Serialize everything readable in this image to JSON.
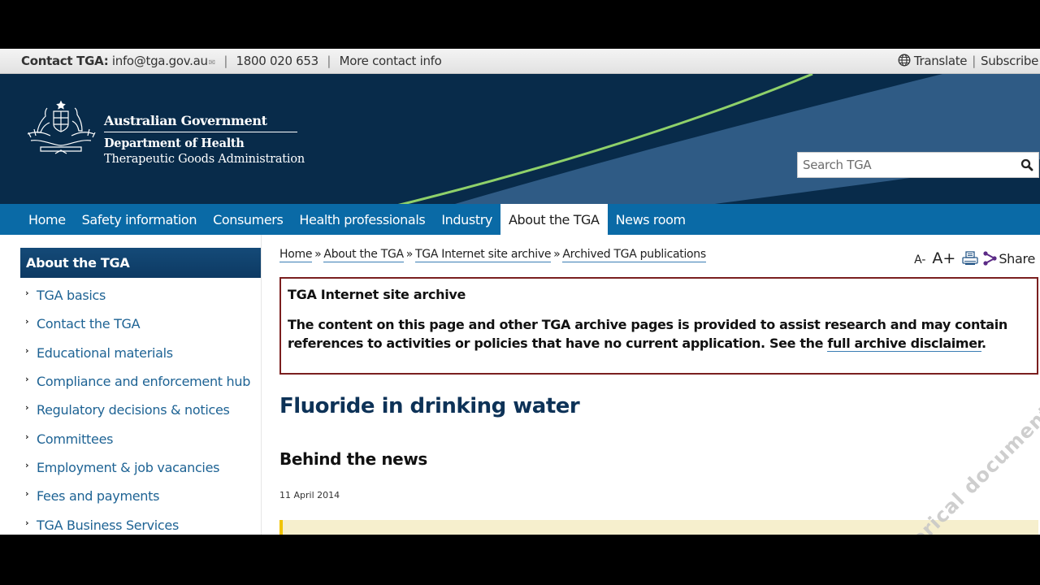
{
  "topbar": {
    "contact_label": "Contact TGA:",
    "email": "info@tga.gov.au",
    "phone": "1800 020 653",
    "more_contact": "More contact info",
    "translate": "Translate",
    "subscribe": "Subscribe",
    "separator": "|"
  },
  "header": {
    "government": "Australian Government",
    "department": "Department of Health",
    "agency": "Therapeutic Goods Administration",
    "search_placeholder": "Search TGA"
  },
  "nav": {
    "items": [
      {
        "label": "Home",
        "active": false
      },
      {
        "label": "Safety information",
        "active": false
      },
      {
        "label": "Consumers",
        "active": false
      },
      {
        "label": "Health professionals",
        "active": false
      },
      {
        "label": "Industry",
        "active": false
      },
      {
        "label": "About the TGA",
        "active": true
      },
      {
        "label": "News room",
        "active": false
      }
    ]
  },
  "sidebar": {
    "heading": "About the TGA",
    "items": [
      {
        "label": "TGA basics"
      },
      {
        "label": "Contact the TGA"
      },
      {
        "label": "Educational materials"
      },
      {
        "label": "Compliance and enforcement hub"
      },
      {
        "label": "Regulatory decisions & notices"
      },
      {
        "label": "Committees"
      },
      {
        "label": "Employment & job vacancies"
      },
      {
        "label": "Fees and payments"
      },
      {
        "label": "TGA Business Services"
      }
    ]
  },
  "breadcrumb": {
    "items": [
      "Home",
      "About the TGA",
      "TGA Internet site archive",
      "Archived TGA publications"
    ],
    "separator": "»"
  },
  "tools": {
    "decrease_font": "A-",
    "increase_font": "A+",
    "share": "Share"
  },
  "archive_notice": {
    "title": "TGA Internet site archive",
    "body": "The content on this page and other TGA archive pages is provided to assist research and may contain references to activities or policies that have no current application. See the ",
    "link": "full archive disclaimer",
    "end": "."
  },
  "article": {
    "title": "Fluoride in drinking water",
    "subtitle": "Behind the news",
    "date": "11 April 2014"
  },
  "watermark": "Historical document",
  "colors": {
    "header_bg": "#082b4a",
    "nav_bg": "#0a6aa6",
    "link": "#1e6394",
    "accent_line": "#8fd16a",
    "archive_border": "#7a1f1f",
    "notice_bg": "#f6efcd",
    "notice_bar": "#f0c300"
  }
}
